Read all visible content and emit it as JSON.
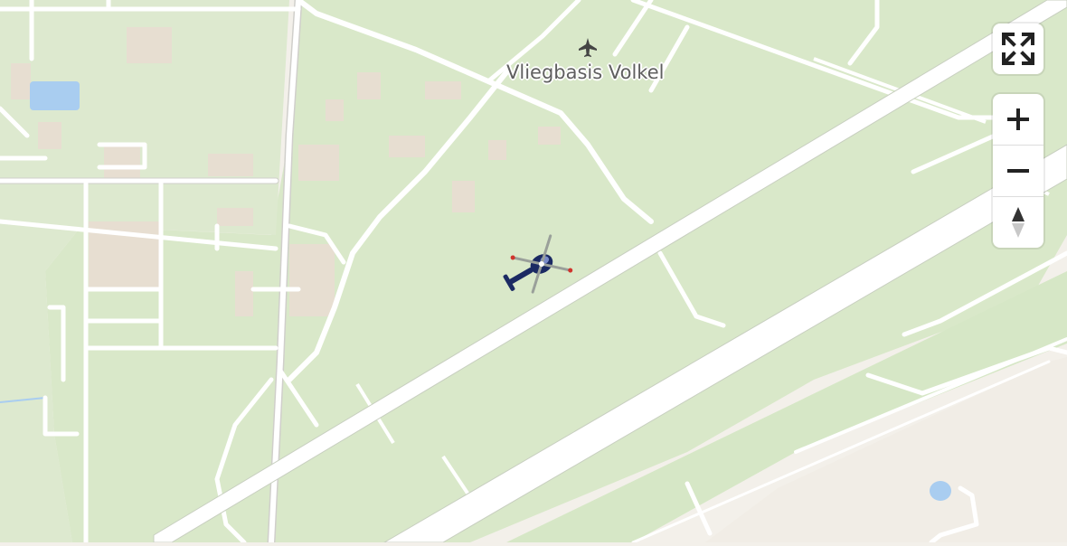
{
  "map": {
    "poi_label": "Vliegbasis Volkel",
    "poi_icon": "airport-icon",
    "marker_icon": "helicopter-icon",
    "colors": {
      "background": "#f3f0ea",
      "airfield_grass": "#d9e8c9",
      "field_grass": "#d6e7c6",
      "runway": "#ffffff",
      "road": "#ffffff",
      "water": "#a9cdf0",
      "building": "#e6dfd3",
      "helicopter_body": "#1b2a63",
      "helicopter_accent": "#d0342c"
    }
  },
  "controls": {
    "fullscreen_icon": "fullscreen-icon",
    "zoom_in_icon": "zoom-in-icon",
    "zoom_out_icon": "zoom-out-icon",
    "compass_icon": "compass-icon"
  }
}
